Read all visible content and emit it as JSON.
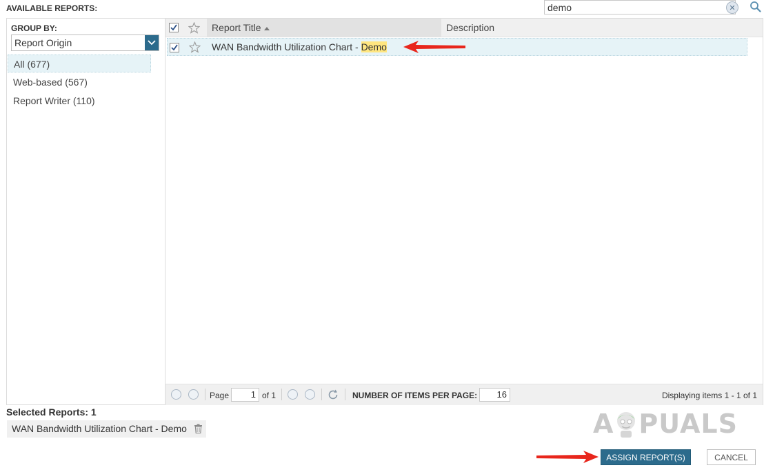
{
  "header": {
    "title": "AVAILABLE REPORTS:"
  },
  "search": {
    "value": "demo",
    "clear_icon": "clear-icon",
    "search_icon": "search-icon"
  },
  "group_by": {
    "label": "GROUP BY:",
    "selected": "Report Origin",
    "items": [
      {
        "label": "All (677)",
        "selected": true
      },
      {
        "label": "Web-based (567)",
        "selected": false
      },
      {
        "label": "Report Writer (110)",
        "selected": false
      }
    ]
  },
  "grid": {
    "columns": {
      "title": "Report Title",
      "description": "Description",
      "sort": "ascending"
    },
    "rows": [
      {
        "title_prefix": "WAN Bandwidth Utilization Chart - ",
        "title_highlight": "Demo",
        "description": "",
        "checked": true,
        "favorite": false
      }
    ]
  },
  "pager": {
    "page_label": "Page",
    "page_value": "1",
    "of_label": "of 1",
    "items_per_page_label": "NUMBER OF ITEMS PER PAGE:",
    "items_per_page_value": "16",
    "display_text": "Displaying items 1 - 1 of 1"
  },
  "selected": {
    "label": "Selected Reports: 1",
    "items": [
      {
        "label": "WAN Bandwidth Utilization Chart - Demo"
      }
    ]
  },
  "logo": {
    "text_left": "A",
    "text_right": "PUALS"
  },
  "actions": {
    "assign_label": "ASSIGN REPORT(S)",
    "cancel_label": "CANCEL"
  },
  "colors": {
    "accent": "#2c6b8c",
    "row_highlight": "#e6f3f7",
    "text_highlight": "#ffe680",
    "arrow": "#e8261c"
  }
}
